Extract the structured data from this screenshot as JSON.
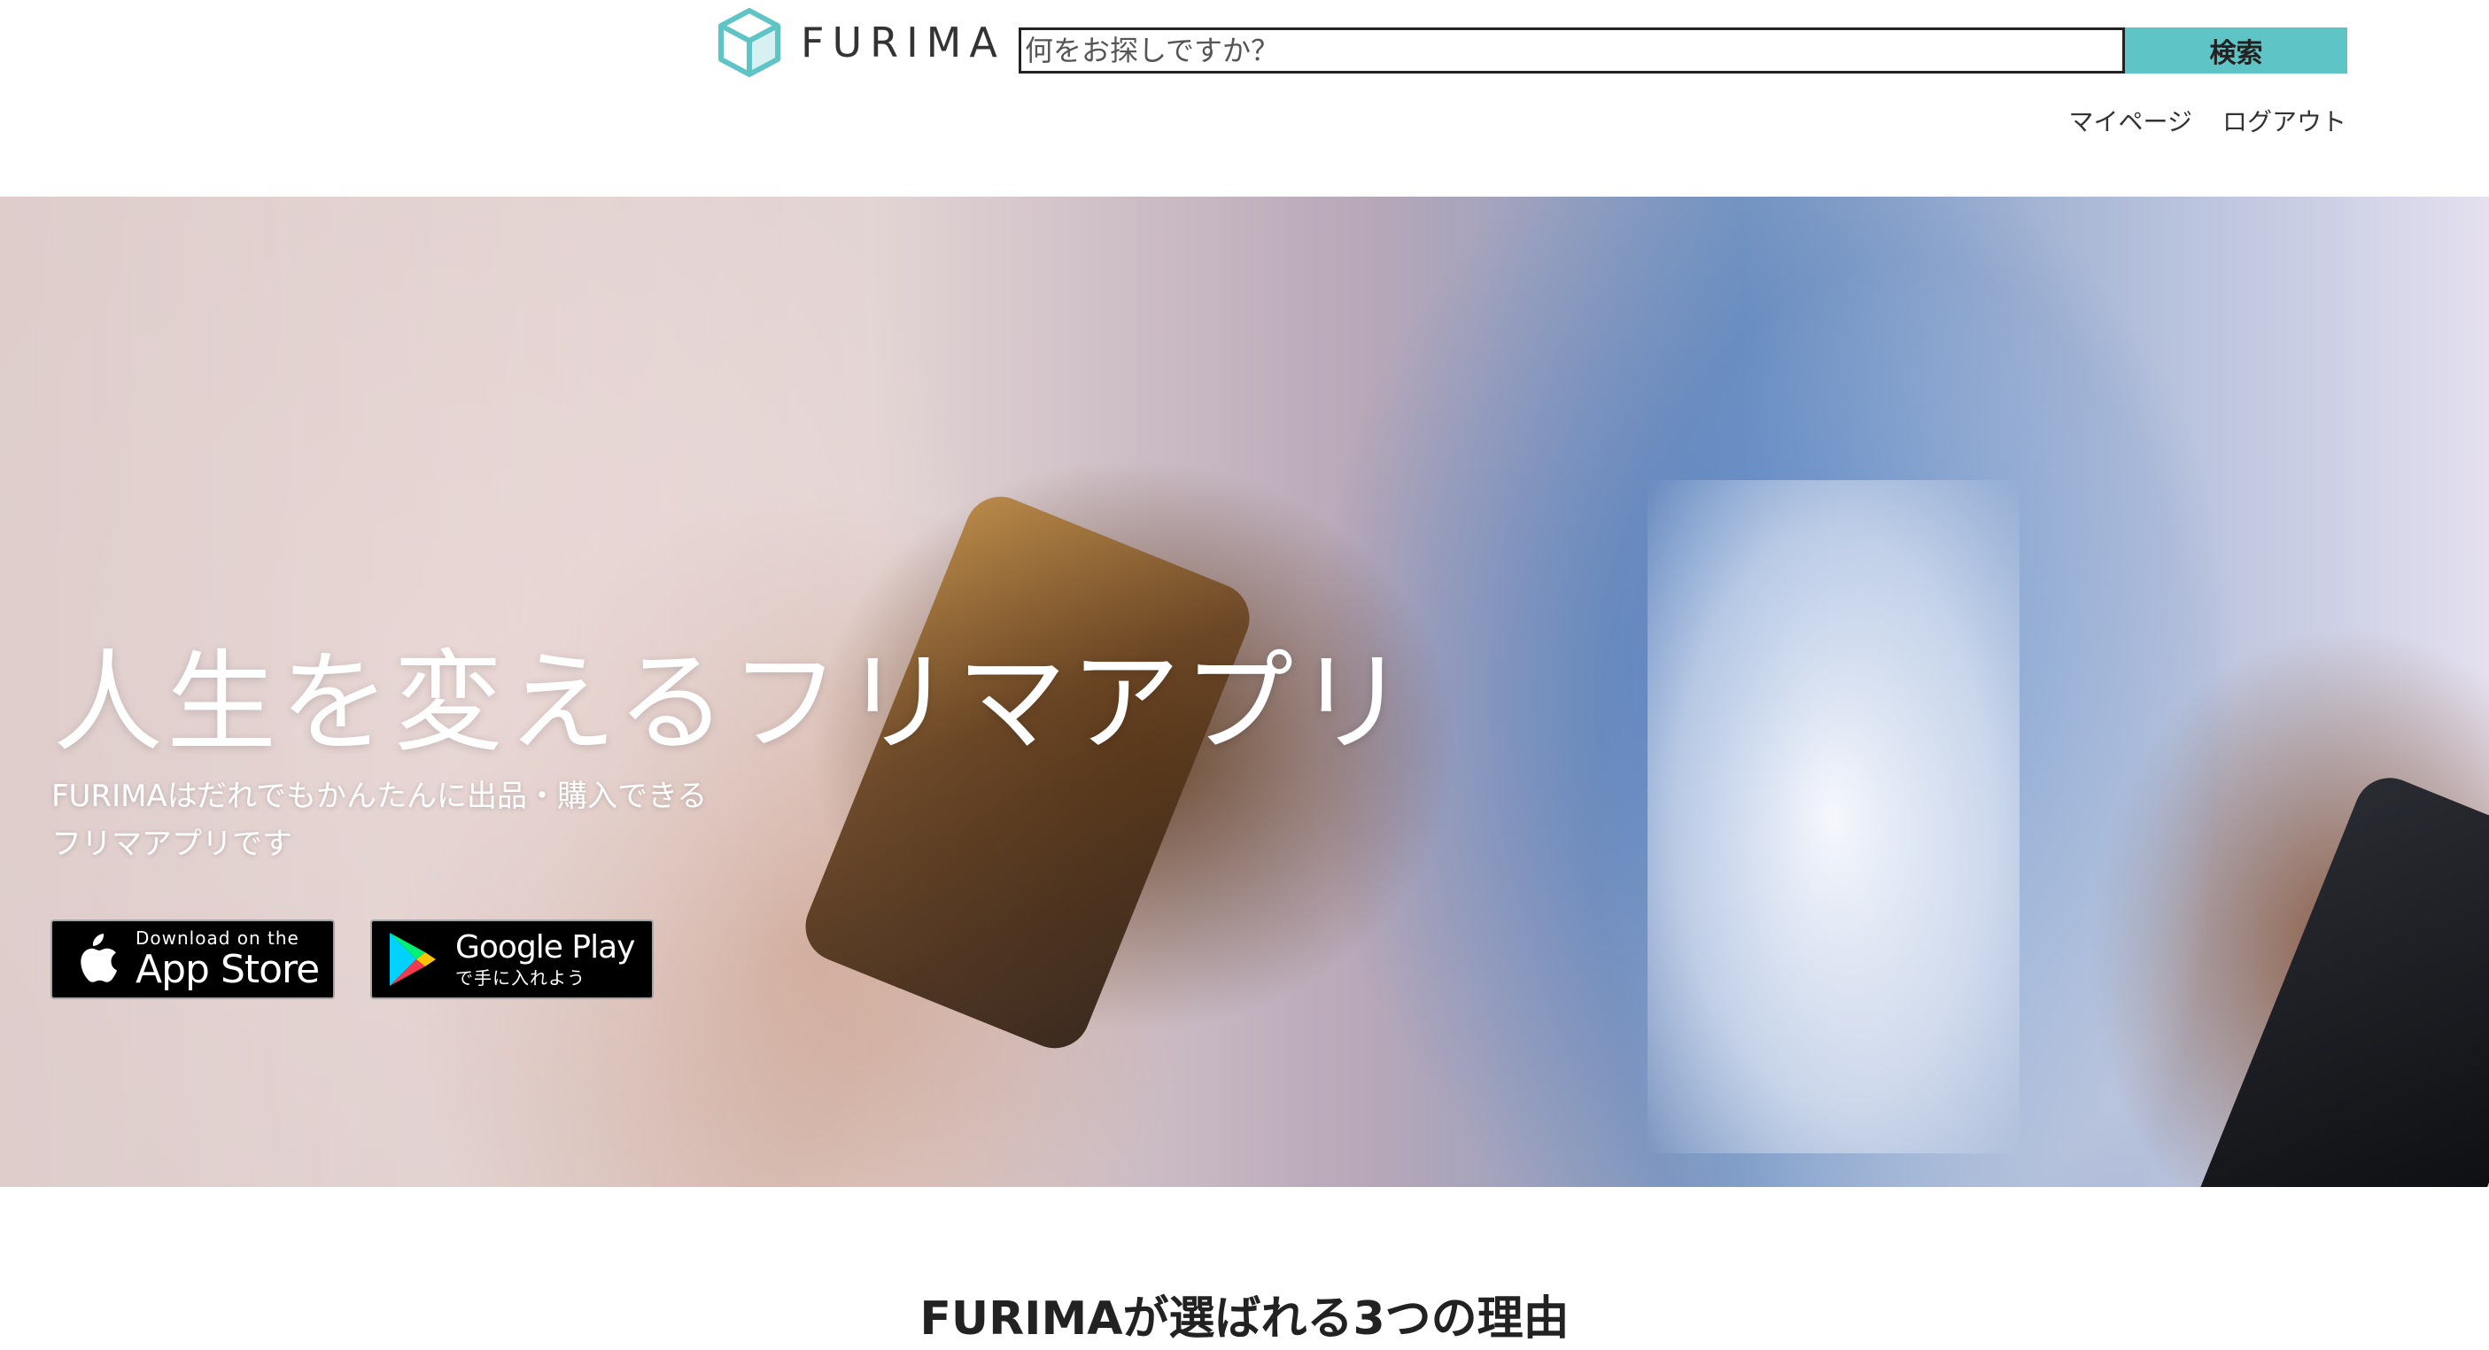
{
  "header": {
    "logo_text": "FURIMA",
    "search": {
      "placeholder": "何をお探しですか？",
      "value": "",
      "button_label": "検索"
    },
    "user_nav": {
      "mypage_label": "マイページ",
      "logout_label": "ログアウト"
    }
  },
  "hero": {
    "title": "人生を変えるフリマアプリ",
    "lead_lines": [
      "FURIMAはだれでもかんたんに出品・購入できる",
      "フリマアプリです"
    ],
    "badges": {
      "app_store": {
        "small_text": "Download on the",
        "large_text": "App Store",
        "icon": "apple-icon"
      },
      "google_play": {
        "large_text": "Google Play",
        "small_text": "で手に入れよう",
        "icon": "google-play-icon"
      }
    }
  },
  "reasons": {
    "title": "FURIMAが選ばれる3つの理由"
  },
  "colors": {
    "accent": "#5fc4c6",
    "logo_teal": "#5fc4c6",
    "text_dark": "#333333"
  }
}
